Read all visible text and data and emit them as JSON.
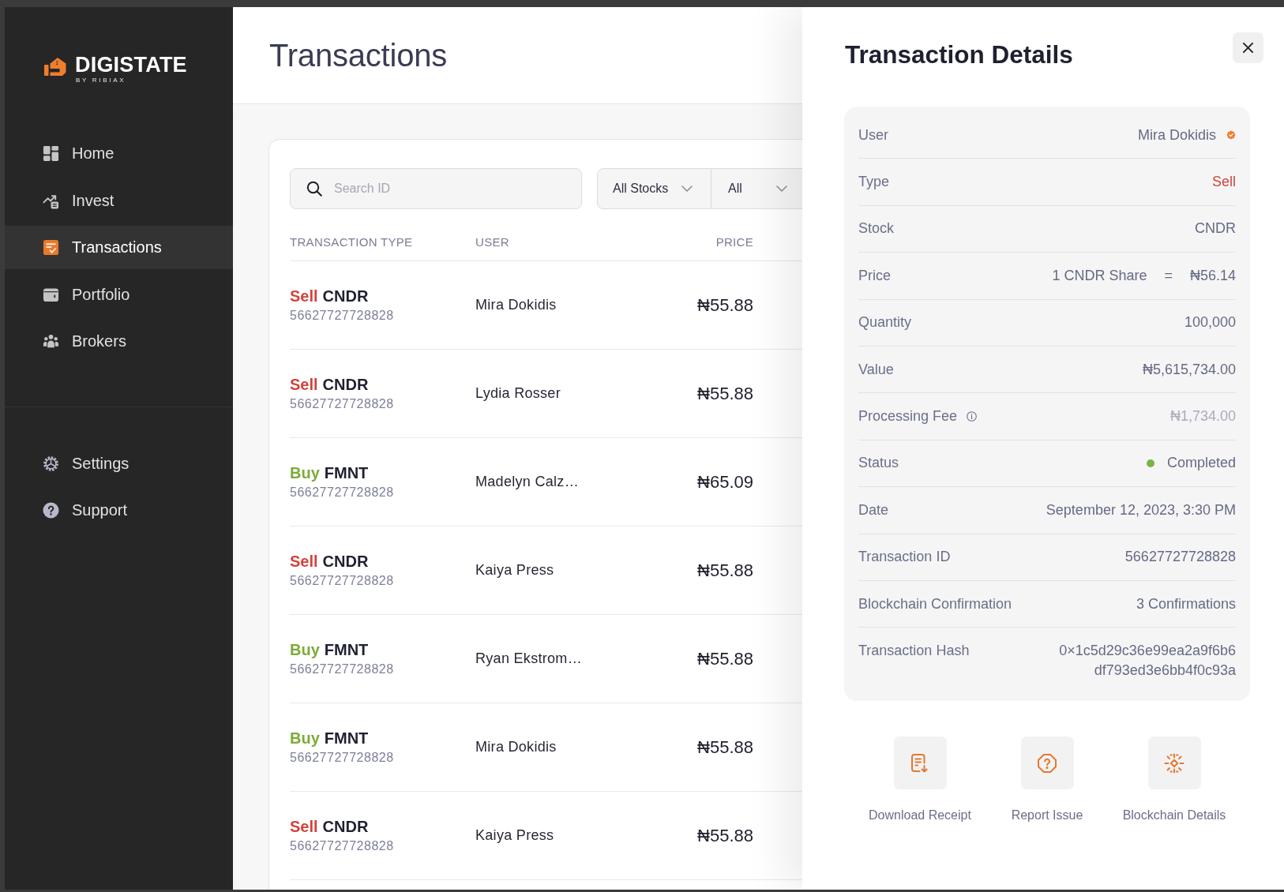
{
  "sidebar": {
    "logo": {
      "name": "DIGISTATE",
      "tagline": "BY RIBIAX"
    },
    "nav_items": [
      {
        "label": "Home",
        "selected": false
      },
      {
        "label": "Invest",
        "selected": false
      },
      {
        "label": "Transactions",
        "selected": true
      },
      {
        "label": "Portfolio",
        "selected": false
      },
      {
        "label": "Brokers",
        "selected": false
      }
    ],
    "bottom_items": [
      {
        "label": "Settings",
        "selected": false
      },
      {
        "label": "Support",
        "selected": false
      }
    ]
  },
  "header": {
    "title": "Transactions"
  },
  "filters": {
    "search": {
      "placeholder": "Search ID"
    },
    "dropdowns": [
      {
        "value": "All Stocks"
      },
      {
        "value": "All"
      }
    ]
  },
  "table": {
    "columns": [
      "TRANSACTION TYPE",
      "USER",
      "PRICE"
    ],
    "rows": [
      {
        "kind": "sell",
        "type": "Sell",
        "stock": "CNDR",
        "id": "56627727728828",
        "user": "Mira Dokidis",
        "price": "₦55.88"
      },
      {
        "kind": "sell",
        "type": "Sell",
        "stock": "CNDR",
        "id": "56627727728828",
        "user": "Lydia Rosser",
        "price": "₦55.88"
      },
      {
        "kind": "buy",
        "type": "Buy",
        "stock": "FMNT",
        "id": "56627727728828",
        "user": "Madelyn Calz…",
        "price": "₦65.09"
      },
      {
        "kind": "sell",
        "type": "Sell",
        "stock": "CNDR",
        "id": "56627727728828",
        "user": "Kaiya Press",
        "price": "₦55.88"
      },
      {
        "kind": "buy",
        "type": "Buy",
        "stock": "FMNT",
        "id": "56627727728828",
        "user": "Ryan Ekstrom…",
        "price": "₦55.88"
      },
      {
        "kind": "buy",
        "type": "Buy",
        "stock": "FMNT",
        "id": "56627727728828",
        "user": "Mira Dokidis",
        "price": "₦55.88"
      },
      {
        "kind": "sell",
        "type": "Sell",
        "stock": "CNDR",
        "id": "56627727728828",
        "user": "Kaiya Press",
        "price": "₦55.88"
      }
    ]
  },
  "details_panel": {
    "title": "Transaction Details",
    "rows": [
      {
        "kind": "user",
        "label": "User",
        "value": "Mira Dokidis",
        "verified": true
      },
      {
        "kind": "sell",
        "label": "Type",
        "value": "Sell"
      },
      {
        "kind": "text",
        "label": "Stock",
        "value": "CNDR"
      },
      {
        "kind": "rate",
        "label": "Price",
        "value": "1 CNDR Share",
        "operator": "=",
        "rate": "₦56.14"
      },
      {
        "kind": "text",
        "label": "Quantity",
        "value": "100,000"
      },
      {
        "kind": "text",
        "label": "Value",
        "value": "₦5,615,734.00"
      },
      {
        "kind": "fee",
        "label": "Processing Fee",
        "value": "₦1,734.00",
        "muted": true
      },
      {
        "kind": "status",
        "label": "Status",
        "value": "Completed",
        "color": "#7cb342"
      },
      {
        "kind": "text",
        "label": "Date",
        "value": "September 12, 2023, 3:30 PM"
      },
      {
        "kind": "text",
        "label": "Transaction ID",
        "value": "56627727728828"
      },
      {
        "kind": "text",
        "label": "Blockchain Confirmation",
        "value": "3 Confirmations"
      },
      {
        "kind": "hash",
        "label": "Transaction Hash",
        "value": "0×1c5d29c36e99ea2a9f6b6df793ed3e6bb4f0c93a"
      }
    ],
    "actions": [
      {
        "label": "Download Receipt"
      },
      {
        "label": "Report Issue"
      },
      {
        "label": "Blockchain Details"
      }
    ]
  }
}
